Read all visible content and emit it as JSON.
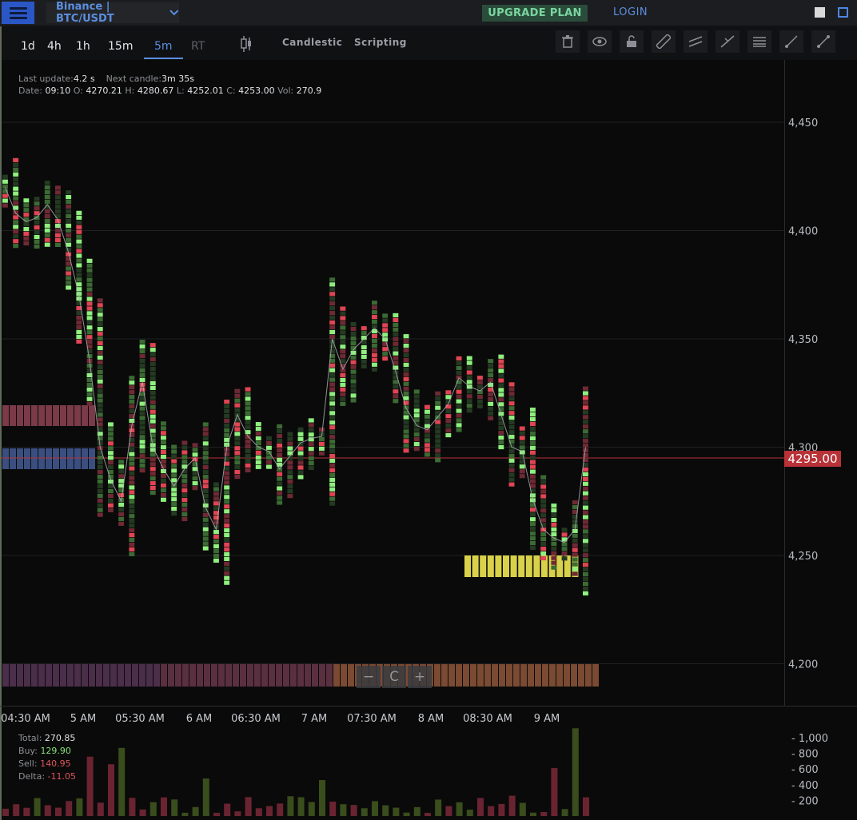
{
  "header": {
    "pair_label": "Binance | BTC/USDT",
    "upgrade_label": "UPGRADE PLAN",
    "login_label": "LOGIN"
  },
  "toolbar": {
    "timeframes": [
      "1d",
      "4h",
      "1h",
      "15m",
      "5m",
      "RT"
    ],
    "active_timeframe": "5m",
    "chart_type_label": "Candlestic",
    "scripting_label": "Scripting",
    "right_icons": [
      "trash-icon",
      "eye-icon",
      "unlock-icon",
      "ruler-icon",
      "parallel-lines-icon",
      "fork-icon",
      "list-lines-icon",
      "ray-icon",
      "line-icon"
    ]
  },
  "info": {
    "last_update_label": "Last update:",
    "last_update_value": "4.2 s",
    "next_candle_label": "Next candle:",
    "next_candle_value": "3m 35s",
    "date_label": "Date:",
    "date_value": "09:10",
    "open_label": "O:",
    "open_value": "4270.21",
    "high_label": "H:",
    "high_value": "4280.67",
    "low_label": "L:",
    "low_value": "4252.01",
    "close_label": "C:",
    "close_value": "4253.00",
    "vol_label": "Vol:",
    "vol_value": "270.9"
  },
  "price_tag": "4295.00",
  "zoom_controls": [
    "−",
    "C",
    "+"
  ],
  "volume_stats": {
    "total_label": "Total:",
    "total_value": "270.85",
    "buy_label": "Buy:",
    "buy_value": "129.90",
    "sell_label": "Sell:",
    "sell_value": "140.95",
    "delta_label": "Delta:",
    "delta_value": "-11.05"
  },
  "colors": {
    "accent": "#5b8fe0",
    "buy": "#86e27a",
    "sell": "#e0535d",
    "highlight": "#e0d84a",
    "price_line": "#b83238"
  },
  "chart_data": {
    "type": "heatmap",
    "price_axis": {
      "ticks": [
        4200,
        4250,
        4300,
        4350,
        4400,
        4450
      ],
      "tick_labels": [
        "4,200",
        "4,250",
        "4,300",
        "4,350",
        "4,400",
        "4,450"
      ],
      "range": [
        4180,
        4480
      ]
    },
    "time_axis": {
      "tick_labels": [
        "04:30 AM",
        "5 AM",
        "05:30 AM",
        "6 AM",
        "06:30 AM",
        "7 AM",
        "07:30 AM",
        "8 AM",
        "08:30 AM",
        "9 AM"
      ]
    },
    "current_price": 4295.0,
    "mid_price_series": [
      4420,
      4408,
      4404,
      4406,
      4412,
      4405,
      4390,
      4370,
      4340,
      4300,
      4285,
      4275,
      4310,
      4330,
      4300,
      4290,
      4282,
      4290,
      4295,
      4272,
      4262,
      4300,
      4315,
      4305,
      4300,
      4298,
      4290,
      4296,
      4302,
      4304,
      4305,
      4350,
      4336,
      4345,
      4350,
      4355,
      4350,
      4335,
      4318,
      4310,
      4308,
      4314,
      4320,
      4332,
      4328,
      4326,
      4330,
      4315,
      4300,
      4298,
      4276,
      4262,
      4258,
      4256,
      4262,
      4300
    ],
    "volume_axis": {
      "ticks": [
        200,
        400,
        600,
        800,
        1000
      ],
      "tick_labels": [
        "200",
        "400",
        "600",
        "800",
        "1,000"
      ]
    }
  }
}
